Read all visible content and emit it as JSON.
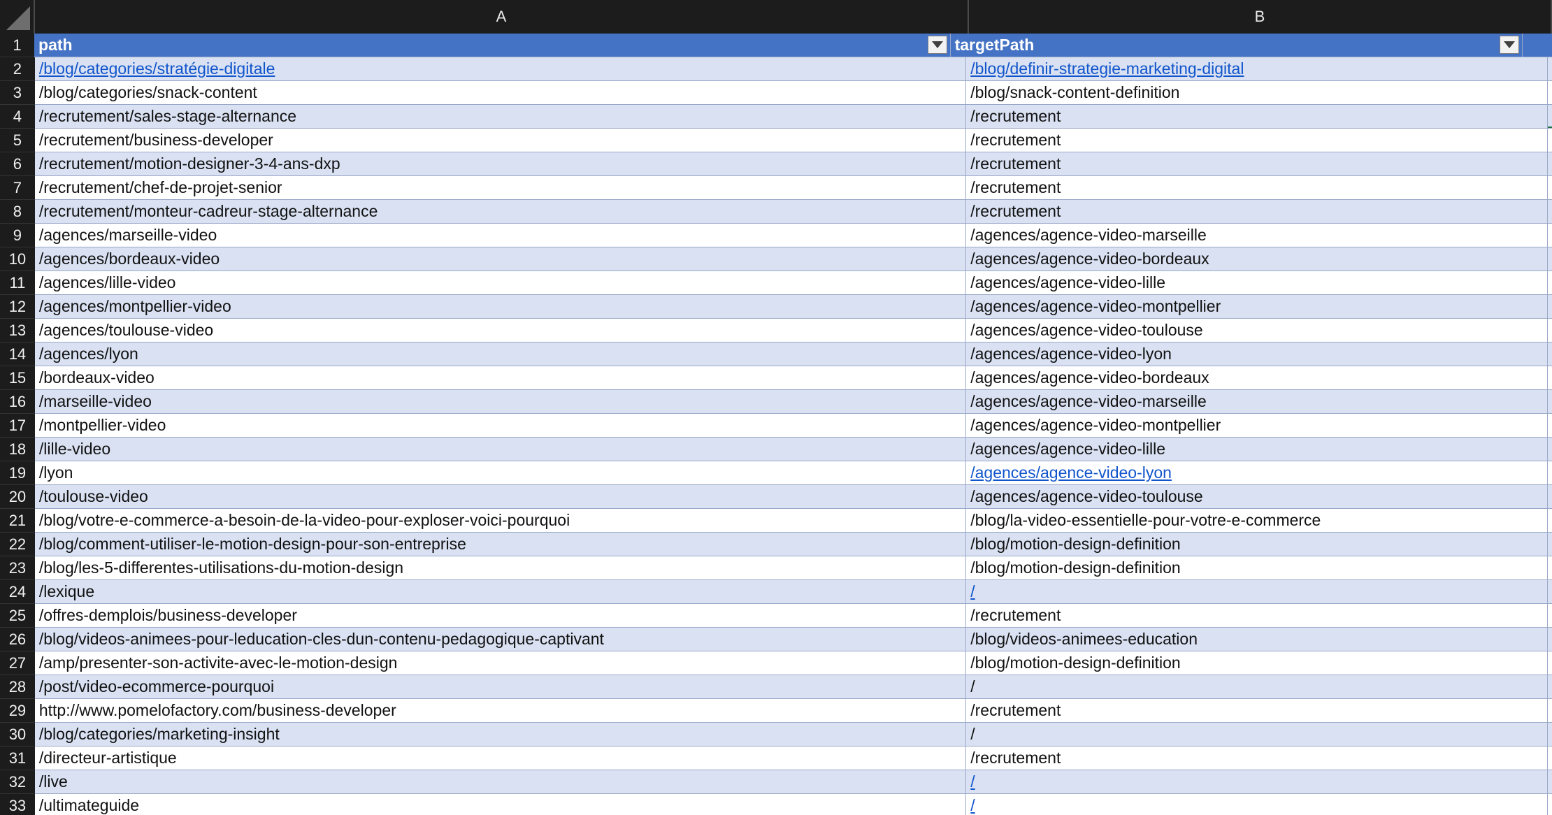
{
  "columns": [
    "A",
    "B"
  ],
  "header": {
    "row": "1",
    "path": "path",
    "targetPath": "targetPath"
  },
  "rows": [
    {
      "n": "2",
      "path": "/blog/categories/stratégie-digitale",
      "target": "/blog/definir-strategie-marketing-digital",
      "path_link": true,
      "target_link": true
    },
    {
      "n": "3",
      "path": "/blog/categories/snack-content",
      "target": "/blog/snack-content-definition"
    },
    {
      "n": "4",
      "path": "/recrutement/sales-stage-alternance",
      "target": "/recrutement"
    },
    {
      "n": "5",
      "path": "/recrutement/business-developer",
      "target": "/recrutement"
    },
    {
      "n": "6",
      "path": "/recrutement/motion-designer-3-4-ans-dxp",
      "target": "/recrutement"
    },
    {
      "n": "7",
      "path": "/recrutement/chef-de-projet-senior",
      "target": "/recrutement"
    },
    {
      "n": "8",
      "path": "/recrutement/monteur-cadreur-stage-alternance",
      "target": "/recrutement"
    },
    {
      "n": "9",
      "path": "/agences/marseille-video",
      "target": "/agences/agence-video-marseille"
    },
    {
      "n": "10",
      "path": "/agences/bordeaux-video",
      "target": "/agences/agence-video-bordeaux"
    },
    {
      "n": "11",
      "path": "/agences/lille-video",
      "target": "/agences/agence-video-lille"
    },
    {
      "n": "12",
      "path": "/agences/montpellier-video",
      "target": "/agences/agence-video-montpellier"
    },
    {
      "n": "13",
      "path": "/agences/toulouse-video",
      "target": "/agences/agence-video-toulouse"
    },
    {
      "n": "14",
      "path": "/agences/lyon",
      "target": "/agences/agence-video-lyon"
    },
    {
      "n": "15",
      "path": "/bordeaux-video",
      "target": "/agences/agence-video-bordeaux"
    },
    {
      "n": "16",
      "path": "/marseille-video",
      "target": "/agences/agence-video-marseille"
    },
    {
      "n": "17",
      "path": "/montpellier-video",
      "target": "/agences/agence-video-montpellier"
    },
    {
      "n": "18",
      "path": "/lille-video",
      "target": "/agences/agence-video-lille"
    },
    {
      "n": "19",
      "path": "/lyon",
      "target": "/agences/agence-video-lyon",
      "target_link": true
    },
    {
      "n": "20",
      "path": "/toulouse-video",
      "target": "/agences/agence-video-toulouse"
    },
    {
      "n": "21",
      "path": "/blog/votre-e-commerce-a-besoin-de-la-video-pour-exploser-voici-pourquoi",
      "target": "/blog/la-video-essentielle-pour-votre-e-commerce"
    },
    {
      "n": "22",
      "path": "/blog/comment-utiliser-le-motion-design-pour-son-entreprise",
      "target": "/blog/motion-design-definition"
    },
    {
      "n": "23",
      "path": "/blog/les-5-differentes-utilisations-du-motion-design",
      "target": "/blog/motion-design-definition"
    },
    {
      "n": "24",
      "path": "/lexique",
      "target": "/",
      "target_link": true
    },
    {
      "n": "25",
      "path": "/offres-demplois/business-developer",
      "target": "/recrutement"
    },
    {
      "n": "26",
      "path": "/blog/videos-animees-pour-leducation-cles-dun-contenu-pedagogique-captivant",
      "target": "/blog/videos-animees-education"
    },
    {
      "n": "27",
      "path": "/amp/presenter-son-activite-avec-le-motion-design",
      "target": "/blog/motion-design-definition"
    },
    {
      "n": "28",
      "path": "/post/video-ecommerce-pourquoi",
      "target": "/"
    },
    {
      "n": "29",
      "path": "http://www.pomelofactory.com/business-developer",
      "target": "/recrutement"
    },
    {
      "n": "30",
      "path": "/blog/categories/marketing-insight",
      "target": "/"
    },
    {
      "n": "31",
      "path": "/directeur-artistique",
      "target": "/recrutement"
    },
    {
      "n": "32",
      "path": "/live",
      "target": "/",
      "target_link": true
    },
    {
      "n": "33",
      "path": "/ultimateguide",
      "target": "/",
      "target_link": true
    }
  ],
  "colors": {
    "header_fill": "#4472c4",
    "band_fill": "#d9e1f2",
    "link": "#1155cc",
    "chrome": "#1c1c1c"
  }
}
